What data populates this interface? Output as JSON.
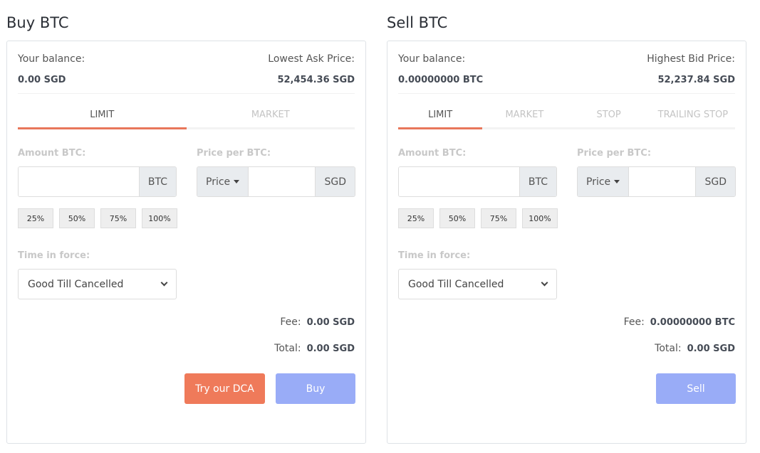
{
  "buy": {
    "title": "Buy BTC",
    "balance_label": "Your balance:",
    "balance_value": "0.00 SGD",
    "price_label": "Lowest Ask Price:",
    "price_value": "52,454.36 SGD",
    "tabs": [
      "LIMIT",
      "MARKET"
    ],
    "active_tab": "LIMIT",
    "amount_label": "Amount BTC:",
    "amount_unit": "BTC",
    "price_per_label": "Price per BTC:",
    "price_dropdown": "Price",
    "price_unit": "SGD",
    "percent_buttons": [
      "25%",
      "50%",
      "75%",
      "100%"
    ],
    "tif_label": "Time in force:",
    "tif_value": "Good Till Cancelled",
    "fee_label": "Fee:",
    "fee_value": "0.00 SGD",
    "total_label": "Total:",
    "total_value": "0.00 SGD",
    "dca_button": "Try our DCA",
    "submit_button": "Buy"
  },
  "sell": {
    "title": "Sell BTC",
    "balance_label": "Your balance:",
    "balance_value": "0.00000000 BTC",
    "price_label": "Highest Bid Price:",
    "price_value": "52,237.84 SGD",
    "tabs": [
      "LIMIT",
      "MARKET",
      "STOP",
      "TRAILING STOP"
    ],
    "active_tab": "LIMIT",
    "amount_label": "Amount BTC:",
    "amount_unit": "BTC",
    "price_per_label": "Price per BTC:",
    "price_dropdown": "Price",
    "price_unit": "SGD",
    "percent_buttons": [
      "25%",
      "50%",
      "75%",
      "100%"
    ],
    "tif_label": "Time in force:",
    "tif_value": "Good Till Cancelled",
    "fee_label": "Fee:",
    "fee_value": "0.00000000 BTC",
    "total_label": "Total:",
    "total_value": "0.00 SGD",
    "submit_button": "Sell"
  },
  "colors": {
    "accent": "#e8765a",
    "submit": "#99acf7",
    "dca": "#ef7a5a"
  }
}
